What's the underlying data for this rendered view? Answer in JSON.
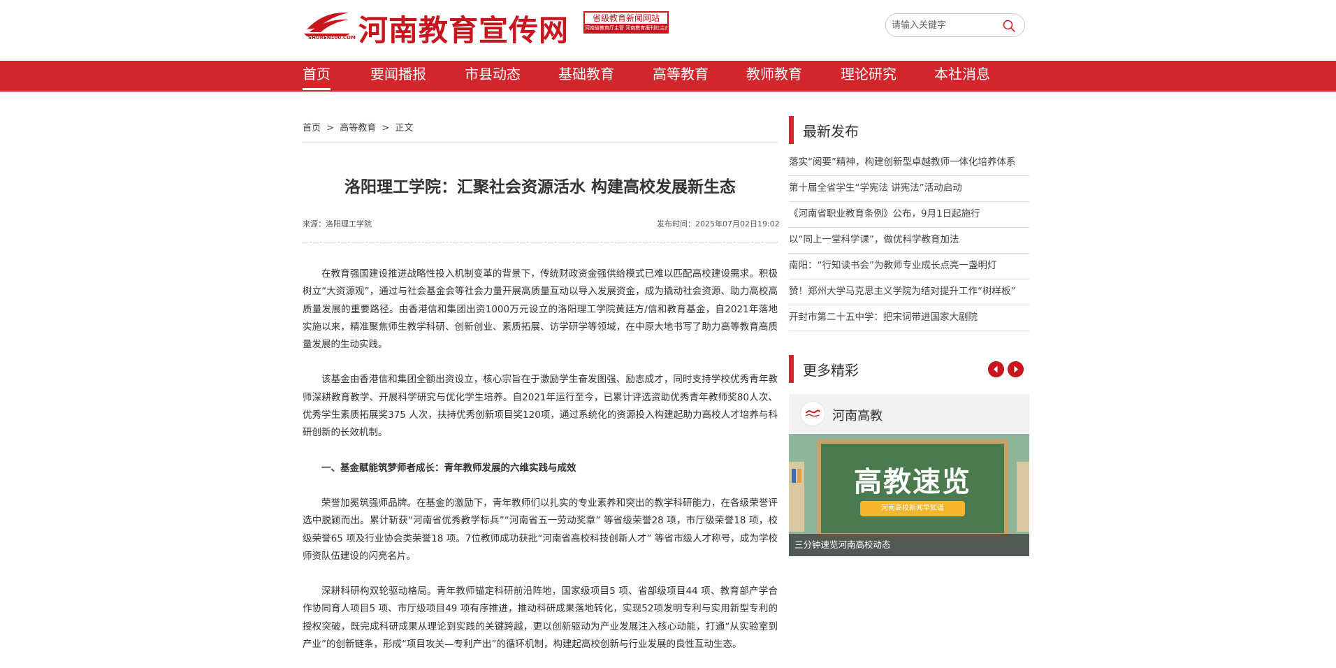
{
  "brand": {
    "title": "河南教育宣传网",
    "sub_mark": "SHUREN100.COM",
    "badge_top": "省级教育新闻网站",
    "badge_bottom": "河南省教育厅主管 河南教育报刊社主办",
    "color": "#c8161e"
  },
  "search": {
    "placeholder": "请输入关键字",
    "icon": "search-icon"
  },
  "nav": {
    "color": "#d0262c",
    "items": [
      "首页",
      "要闻播报",
      "市县动态",
      "基础教育",
      "高等教育",
      "教师教育",
      "理论研究",
      "本社消息"
    ],
    "active_index": 0
  },
  "breadcrumb": [
    "首页",
    ">",
    "高等教育",
    ">",
    "正文"
  ],
  "article": {
    "title": "洛阳理工学院：汇聚社会资源活水 构建高校发展新生态",
    "source": "来源：洛阳理工学院",
    "time": "发布时间：2025年07月02日19:02",
    "paragraphs": [
      "在教育强国建设推进战略性投入机制变革的背景下，传统财政资金强供给模式已难以匹配高校建设需求。积极树立“大资源观”，通过与社会基金会等社会力量开展高质量互动以导入发展资金，成为撬动社会资源、助力高校高质量发展的重要路径。由香港信和集团出资1000万元设立的洛阳理工学院黄廷方/信和教育基金，自2021年落地实施以来，精准聚焦师生教学科研、创新创业、素质拓展、访学研学等领域，在中原大地书写了助力高等教育高质量发展的生动实践。",
      "该基金由香港信和集团全额出资设立，核心宗旨在于激励学生奋发图强、励志成才，同时支持学校优秀青年教师深耕教育教学、开展科学研究与优化学生培养。自2021年运行至今，已累计评选资助优秀青年教师奖80人次、优秀学生素质拓展奖375 人次，扶持优秀创新项目奖120项，通过系统化的资源投入构建起助力高校人才培养与科研创新的长效机制。",
      "一、基金赋能筑梦师者成长：青年教师发展的六维实践与成效",
      "荣誉加冕筑强师品牌。在基金的激励下，青年教师们以扎实的专业素养和突出的教学科研能力，在各级荣誉评选中脱颖而出。累计斩获“河南省优秀教学标兵”“河南省五一劳动奖章” 等省级荣誉28 项，市厅级荣誉18 项，校级荣誉65 项及行业协会类荣誉18 项。7位教师成功获批“河南省高校科技创新人才” 等省市级人才称号，成为学校师资队伍建设的闪亮名片。",
      "深耕科研构双轮驱动格局。青年教师锚定科研前沿阵地，国家级项目5 项、省部级项目44 项、教育部产学合作协同育人项目5 项、市厅级项目49 项有序推进，推动科研成果落地转化，实现52项发明专利与实用新型专利的授权突破，既完成科研成果从理论到实践的关键跨越，更以创新驱动为产业发展注入核心动能，打通“从实验室到产业”的创新链条，形成“项目攻关—专利产出”的循环机制，构建起高校创新与行业发展的良性互动生态。"
    ]
  },
  "sidebar": {
    "latest_title": "最新发布",
    "latest": [
      "落实“阅要”精神，构建创新型卓越教师一体化培养体系",
      "第十届全省学生“学宪法 讲宪法”活动启动",
      "《河南省职业教育条例》公布，9月1日起施行",
      "以“同上一堂科学课”，做优科学教育加法",
      "南阳：“行知读书会”为教师专业成长点亮一盏明灯",
      "赞！郑州大学马克思主义学院为结对提升工作“树样板”",
      "开封市第二十五中学：把宋词带进国家大剧院"
    ],
    "more_title": "更多精彩",
    "prev_icon": "arrow-left-icon",
    "next_icon": "arrow-right-icon",
    "card": {
      "name": "河南高教",
      "image_title": "高教速览",
      "image_strip": "河南高校新闻早知道",
      "caption": "三分钟速览河南高校动态"
    }
  }
}
